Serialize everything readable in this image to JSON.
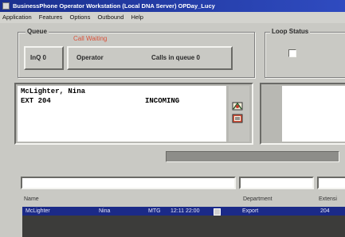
{
  "window": {
    "title": "BusinessPhone Operator Workstation (Local DNA Server) OPDay_Lucy"
  },
  "menu": [
    "Application",
    "Features",
    "Options",
    "Outbound",
    "Help"
  ],
  "queue": {
    "legend": "Queue",
    "status_text": "Call Waiting",
    "inq_label": "InQ 0",
    "operator_label": "Operator",
    "calls_label": "Calls in queue 0"
  },
  "loop_status": {
    "legend": "Loop Status"
  },
  "call": {
    "name": "McLighter, Nina",
    "ext": "EXT 204",
    "state": "INCOMING"
  },
  "directory": {
    "columns": [
      "Name",
      "Department",
      "Extensi"
    ],
    "rows": [
      {
        "last": "McLighter",
        "first": "Nina",
        "code": "MTG",
        "time": "12:11 22:00",
        "department": "Export",
        "extension": "204"
      }
    ]
  },
  "colors": {
    "title_bar": "#1a2f8e",
    "status_red": "#d9523a",
    "selection": "#1b2a88"
  }
}
